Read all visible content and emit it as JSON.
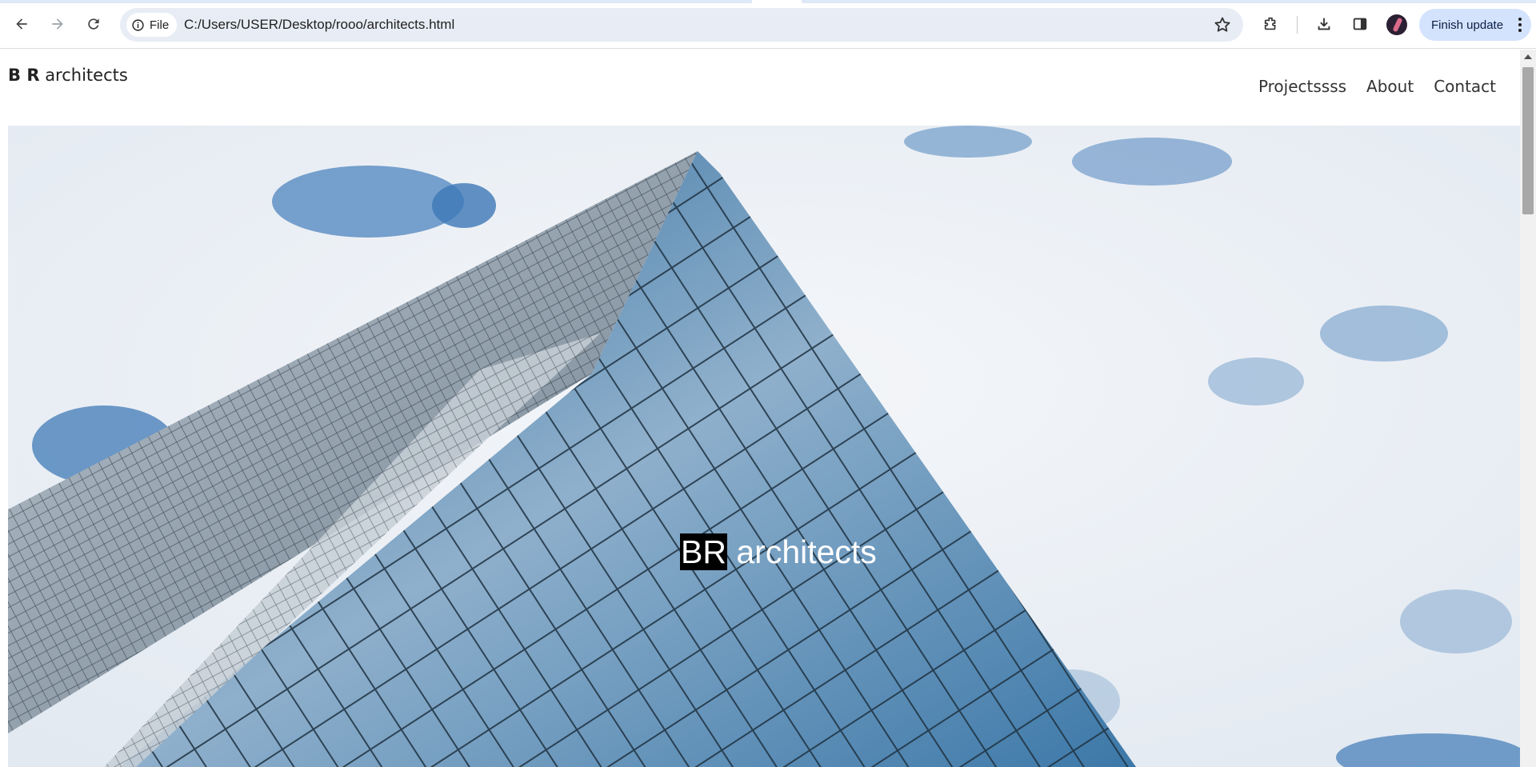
{
  "browser": {
    "site_chip_label": "File",
    "url": "C:/Users/USER/Desktop/rooo/architects.html",
    "update_button": "Finish update",
    "icons": [
      "back-arrow-icon",
      "forward-arrow-icon",
      "reload-icon",
      "info-icon",
      "star-icon",
      "extensions-icon",
      "download-icon",
      "side-panel-icon",
      "profile-avatar",
      "more-vert-icon"
    ]
  },
  "site": {
    "logo_bold": "B R",
    "logo_text": "architects",
    "nav": {
      "projects": "Projectssss",
      "about": "About",
      "contact": "Contact"
    },
    "hero": {
      "title_highlight": "BR",
      "title_rest": " architects"
    }
  },
  "colors": {
    "chrome_accent": "#d3e3fd",
    "omnibox_bg": "#e8edf5",
    "sky": "#dde6ef",
    "glass_blue": "#2f6d9e"
  }
}
